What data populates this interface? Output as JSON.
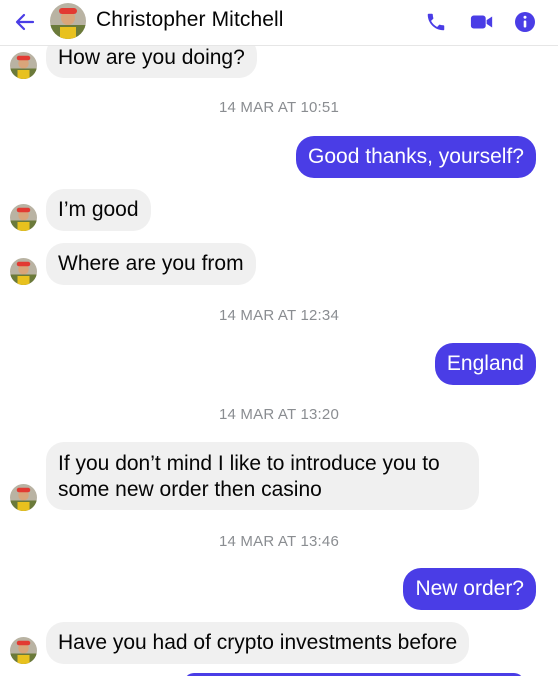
{
  "header": {
    "contact_name": "Christopher Mitchell",
    "back_icon": "arrow-left-icon",
    "actions": [
      "phone-icon",
      "video-camera-icon",
      "info-icon"
    ],
    "accent_color": "#4a3de6"
  },
  "messages": [
    {
      "type": "in",
      "text": "How are you doing?"
    },
    {
      "type": "timestamp",
      "text": "14 MAR AT 10:51"
    },
    {
      "type": "out",
      "text": "Good thanks, yourself?"
    },
    {
      "type": "in",
      "text": "I’m good"
    },
    {
      "type": "in",
      "text": "Where are you from"
    },
    {
      "type": "timestamp",
      "text": "14 MAR AT 12:34"
    },
    {
      "type": "out",
      "text": "England"
    },
    {
      "type": "timestamp",
      "text": "14 MAR AT 13:20"
    },
    {
      "type": "in",
      "text": "If you don’t mind I like to introduce you to some new order then casino"
    },
    {
      "type": "timestamp",
      "text": "14 MAR AT 13:46"
    },
    {
      "type": "out",
      "text": "New order?"
    },
    {
      "type": "in",
      "text": "Have you had of crypto investments before"
    }
  ],
  "colors": {
    "incoming_bubble": "#f0f0f0",
    "outgoing_bubble": "#4a3de6",
    "timestamp_text": "#8a8d91"
  }
}
